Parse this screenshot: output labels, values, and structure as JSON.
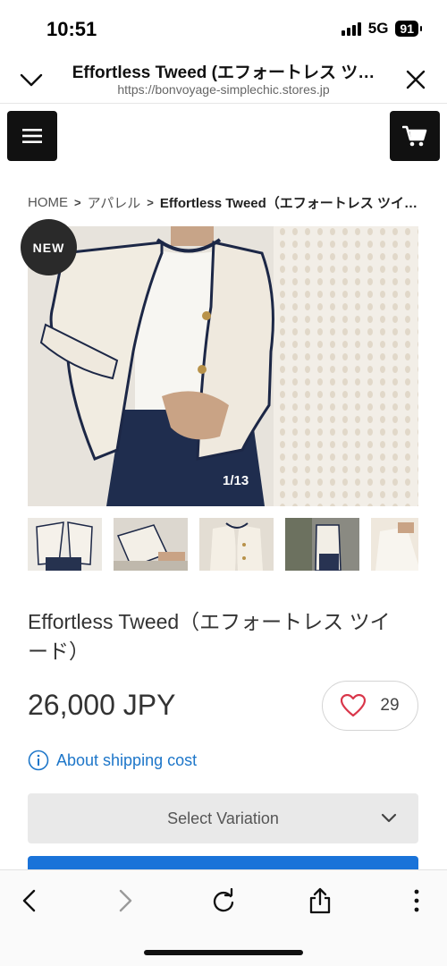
{
  "status_bar": {
    "time": "10:51",
    "network": "5G",
    "battery": "91"
  },
  "browser": {
    "title": "Effortless Tweed (エフォートレス ツ…",
    "url": "https://bonvoyage-simplechic.stores.jp"
  },
  "site_nav": {
    "menu_icon": "hamburger-menu-icon",
    "cart_icon": "cart-icon"
  },
  "breadcrumb": {
    "items": [
      "HOME",
      "アパレル",
      "Effortless Tweed（エフォートレス ツイ…"
    ]
  },
  "gallery": {
    "badge": "NEW",
    "counter": "1/13",
    "thumbnail_count": 5
  },
  "product": {
    "title": "Effortless Tweed（エフォートレス ツイード）",
    "price": "26,000 JPY",
    "favorites": "29",
    "shipping_link": "About shipping cost",
    "variation_placeholder": "Select Variation"
  },
  "colors": {
    "accent_blue": "#1d76c9",
    "cta_blue": "#1a73d9",
    "heart_red": "#d9364a",
    "dark": "#111111"
  },
  "toolbar": {
    "icons": [
      "back-icon",
      "forward-icon",
      "reload-icon",
      "share-icon",
      "more-icon"
    ]
  }
}
